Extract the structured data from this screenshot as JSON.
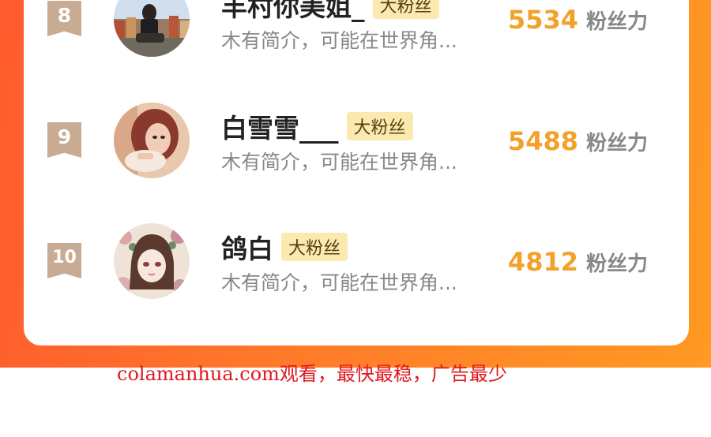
{
  "ranking": [
    {
      "rank": "8",
      "name": "丰村你美姐_",
      "tag": "大粉丝",
      "bio": "木有简介，可能在世界角...",
      "score": "5534",
      "score_unit": "粉丝力",
      "avatar": "avatar-girl-cityscape"
    },
    {
      "rank": "9",
      "name": "白雪雪___",
      "tag": "大粉丝",
      "bio": "木有简介，可能在世界角...",
      "score": "5488",
      "score_unit": "粉丝力",
      "avatar": "avatar-woman-portrait"
    },
    {
      "rank": "10",
      "name": "鸽白",
      "tag": "大粉丝",
      "bio": "木有简介，可能在世界角...",
      "score": "4812",
      "score_unit": "粉丝力",
      "avatar": "avatar-anime-girl-flowers"
    }
  ],
  "footer": {
    "watermark": "colamanhua.com观看，最快最稳，广告最少"
  },
  "colors": {
    "frame_start": "#ff5b2e",
    "frame_end": "#ff9a22",
    "score": "#f2a12a",
    "tag_bg": "#fbeab0",
    "badge": "#c8ab93",
    "watermark": "#e0181f"
  }
}
